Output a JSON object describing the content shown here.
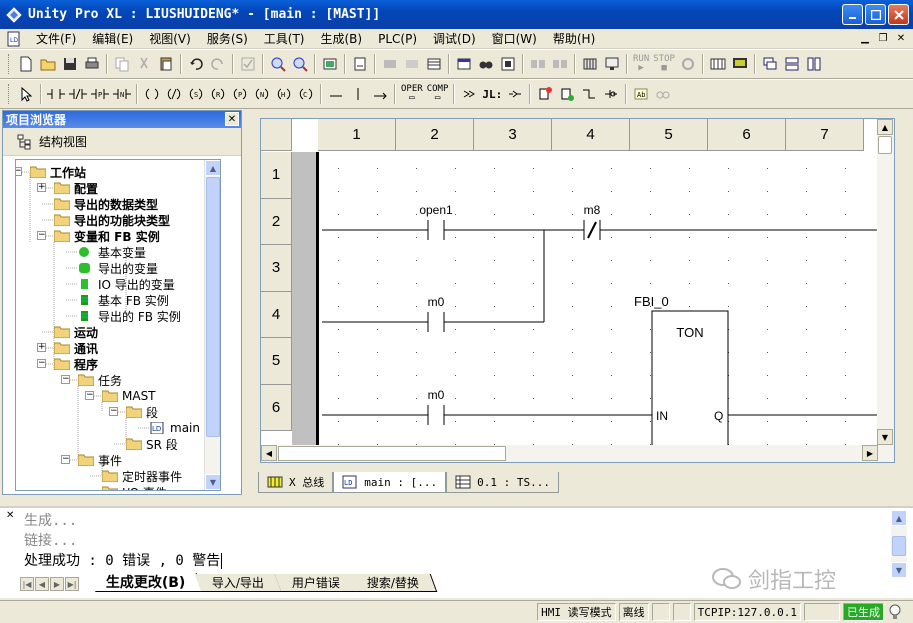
{
  "window": {
    "title": "Unity Pro XL : LIUSHUIDENG* - [main : [MAST]]"
  },
  "menu": {
    "items": [
      "文件(F)",
      "编辑(E)",
      "视图(V)",
      "服务(S)",
      "工具(T)",
      "生成(B)",
      "PLC(P)",
      "调试(D)",
      "窗口(W)",
      "帮助(H)"
    ]
  },
  "toolbar": {
    "run_label": "RUN",
    "stop_label": "STOP",
    "oper_label": "OPER",
    "comp_label": "COMP",
    "jl_label": "JL:"
  },
  "browser": {
    "title": "项目浏览器",
    "view_label": "结构视图",
    "tree": [
      {
        "label": "工作站",
        "bold": true
      },
      {
        "label": "配置",
        "bold": true
      },
      {
        "label": "导出的数据类型",
        "bold": true
      },
      {
        "label": "导出的功能块类型",
        "bold": true
      },
      {
        "label": "变量和 FB 实例",
        "bold": true
      },
      {
        "label": "基本变量",
        "bold": false
      },
      {
        "label": "导出的变量",
        "bold": false
      },
      {
        "label": "IO 导出的变量",
        "bold": false
      },
      {
        "label": "基本 FB 实例",
        "bold": false
      },
      {
        "label": "导出的 FB 实例",
        "bold": false
      },
      {
        "label": "运动",
        "bold": true
      },
      {
        "label": "通讯",
        "bold": true
      },
      {
        "label": "程序",
        "bold": true
      },
      {
        "label": "任务",
        "bold": false
      },
      {
        "label": "MAST",
        "bold": false
      },
      {
        "label": "段",
        "bold": false
      },
      {
        "label": "main",
        "bold": false
      },
      {
        "label": "SR 段",
        "bold": false
      },
      {
        "label": "事件",
        "bold": false
      },
      {
        "label": "定时器事件",
        "bold": false
      },
      {
        "label": "I/O 事件",
        "bold": false
      }
    ],
    "ld_badge": "LD"
  },
  "editor": {
    "columns": [
      "1",
      "2",
      "3",
      "4",
      "5",
      "6",
      "7"
    ],
    "rows": [
      "1",
      "2",
      "3",
      "4",
      "5",
      "6"
    ],
    "contacts": [
      {
        "name": "open1",
        "type": "NO"
      },
      {
        "name": "m8",
        "type": "NC"
      },
      {
        "name": "m0",
        "type": "NO"
      },
      {
        "name": "m0",
        "type": "NO"
      }
    ],
    "fb": {
      "instance": "FBI_0",
      "type": "TON",
      "input": "IN",
      "output": "Q"
    }
  },
  "doc_tabs": [
    {
      "label": "X 总线",
      "active": false
    },
    {
      "label": "main : [...",
      "active": true
    },
    {
      "label": "0.1 : TS...",
      "active": false
    }
  ],
  "output": {
    "lines": [
      "生成...",
      "链接...",
      "处理成功 : 0 错误 , 0 警告"
    ],
    "tabs": [
      "生成更改(B)",
      "导入/导出",
      "用户错误",
      "搜索/替换"
    ]
  },
  "watermark": "剑指工控",
  "status": {
    "hmi_mode": "HMI 读写模式",
    "connection": "离线",
    "address": "TCPIP:127.0.0.1",
    "build_state": "已生成"
  },
  "colors": {
    "title_blue": "#0346b8",
    "selection_blue": "#2c6ae0",
    "built_green": "#26a926"
  }
}
